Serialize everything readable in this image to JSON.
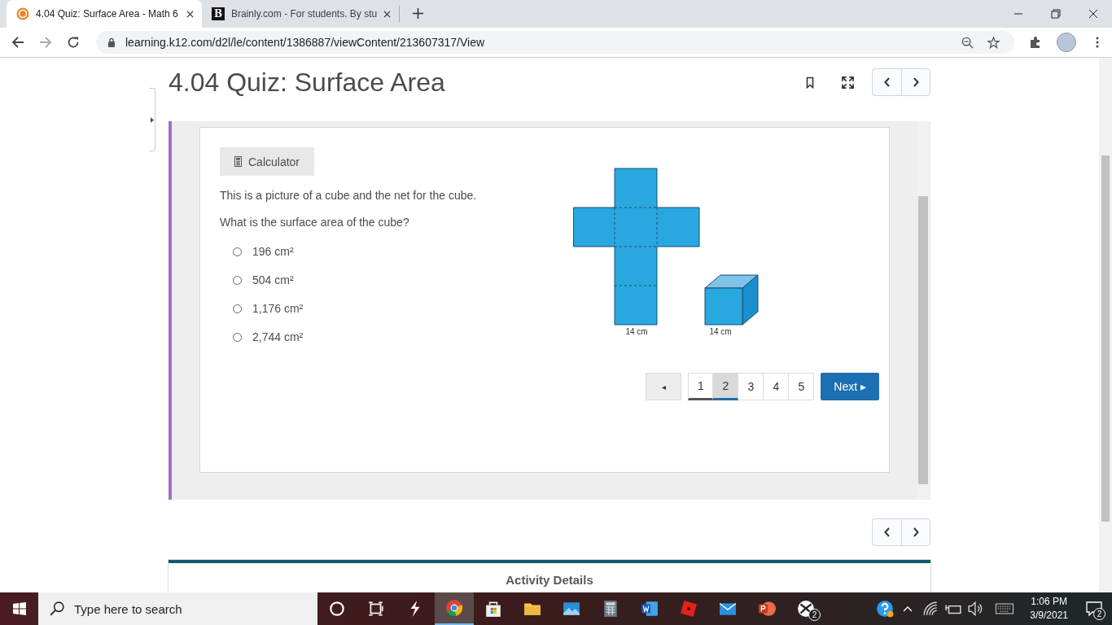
{
  "browser": {
    "tabs": [
      {
        "title": "4.04 Quiz: Surface Area - Math 6",
        "selected": true,
        "kind": "k12"
      },
      {
        "title": "Brainly.com - For students. By stu",
        "selected": false,
        "kind": "letter",
        "icon_text": "B"
      }
    ],
    "url": "learning.k12.com/d2l/le/content/1386887/viewContent/213607317/View"
  },
  "page": {
    "title": "4.04 Quiz: Surface Area",
    "quiz": {
      "calculator": "Calculator",
      "prompt": [
        "This is a picture of a cube and the net for the cube.",
        "What is the surface area of the cube?"
      ],
      "options": [
        {
          "label": "196 cm²",
          "selected": false
        },
        {
          "label": "504 cm²",
          "selected": false
        },
        {
          "label": "1,176 cm²",
          "selected": false
        },
        {
          "label": "2,744 cm²",
          "selected": false
        }
      ],
      "figure_labels": [
        "14 cm",
        "14 cm"
      ],
      "pager": {
        "prev": "◂",
        "pages": [
          {
            "label": "1",
            "selected": false,
            "visited": true
          },
          {
            "label": "2",
            "selected": true,
            "visited": true
          },
          {
            "label": "3",
            "selected": false,
            "visited": false
          },
          {
            "label": "4",
            "selected": false,
            "visited": false
          },
          {
            "label": "5",
            "selected": false,
            "visited": false
          }
        ],
        "next": "Next ▸"
      }
    },
    "activity_details": "Activity Details"
  },
  "taskbar": {
    "search_placeholder": "Type here to search",
    "apps": [
      {
        "kind": "cortana",
        "active": false
      },
      {
        "kind": "taskview",
        "active": false
      },
      {
        "kind": "bolt",
        "active": false
      },
      {
        "kind": "chrome",
        "active": true
      },
      {
        "kind": "store",
        "active": false
      },
      {
        "kind": "folder",
        "active": false
      },
      {
        "kind": "photos",
        "active": false
      },
      {
        "kind": "calculator",
        "active": false
      },
      {
        "kind": "word",
        "active": false
      },
      {
        "kind": "roblox",
        "active": false
      },
      {
        "kind": "mail",
        "active": false
      },
      {
        "kind": "powerpoint",
        "active": false
      },
      {
        "kind": "xbox",
        "active": false,
        "badge": "2"
      }
    ],
    "time": "1:06 PM",
    "date": "3/9/2021",
    "notifications": "2"
  }
}
